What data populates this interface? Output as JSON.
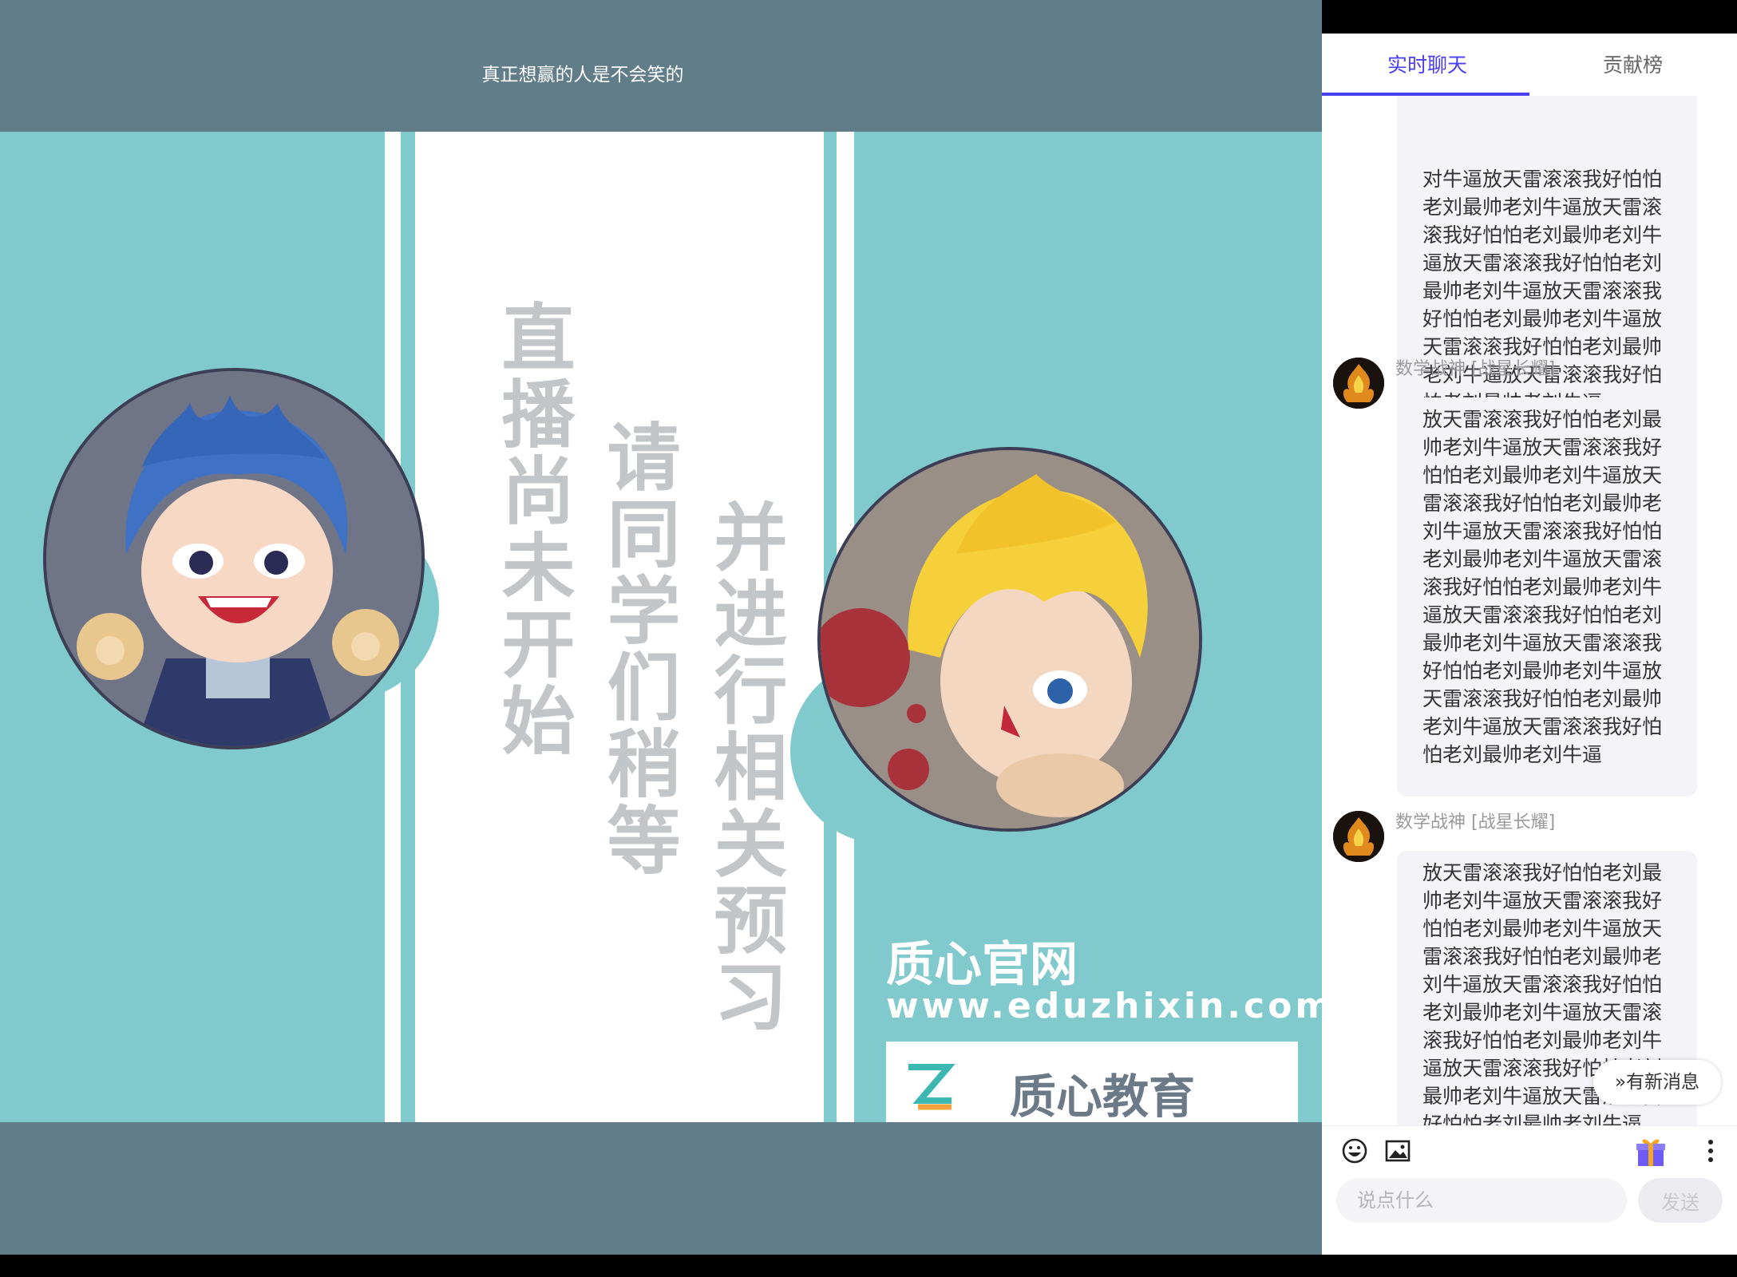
{
  "video": {
    "title": "真正想赢的人是不会笑的",
    "slide_text_1": "直播尚未开始",
    "slide_text_2": "请同学们稍等",
    "slide_text_3": "并进行相关预习",
    "site_name": "质心官网",
    "site_url": "www.eduzhixin.com",
    "brand_name": "质心教育"
  },
  "tabs": [
    {
      "label": "实时聊天",
      "active": true
    },
    {
      "label": "贡献榜",
      "active": false
    }
  ],
  "messages": [
    {
      "user": "",
      "text": "对牛逼放天雷滚滚我好怕怕老刘最帅老刘牛逼放天雷滚滚我好怕怕老刘最帅老刘牛逼放天雷滚滚我好怕怕老刘最帅老刘牛逼放天雷滚滚我好怕怕老刘最帅老刘牛逼放天雷滚滚我好怕怕老刘最帅老刘牛逼放天雷滚滚我好怕怕老刘最帅老刘牛逼"
    },
    {
      "user": "数学战神 [战星长耀]",
      "text": "放天雷滚滚我好怕怕老刘最帅老刘牛逼放天雷滚滚我好怕怕老刘最帅老刘牛逼放天雷滚滚我好怕怕老刘最帅老刘牛逼放天雷滚滚我好怕怕老刘最帅老刘牛逼放天雷滚滚我好怕怕老刘最帅老刘牛逼放天雷滚滚我好怕怕老刘最帅老刘牛逼放天雷滚滚我好怕怕老刘最帅老刘牛逼放天雷滚滚我好怕怕老刘最帅老刘牛逼放天雷滚滚我好怕怕老刘最帅老刘牛逼"
    },
    {
      "user": "数学战神 [战星长耀]",
      "text": "放天雷滚滚我好怕怕老刘最帅老刘牛逼放天雷滚滚我好怕怕老刘最帅老刘牛逼放天雷滚滚我好怕怕老刘最帅老刘牛逼放天雷滚滚我好怕怕老刘最帅老刘牛逼放天雷滚滚我好怕怕老刘最帅老刘牛逼放天雷滚滚我好怕怕老刘最帅老刘牛逼放天雷滚滚我好怕怕老刘最帅老刘牛逼"
    }
  ],
  "new_message_label": "有新消息",
  "input": {
    "placeholder": "说点什么",
    "value": ""
  },
  "send_label": "发送",
  "colors": {
    "accent": "#4b3ff2",
    "slide_teal": "#80c9cc",
    "video_bg": "#627d8a"
  },
  "icons": [
    "emoji-icon",
    "image-icon",
    "gift-icon",
    "more-icon"
  ]
}
